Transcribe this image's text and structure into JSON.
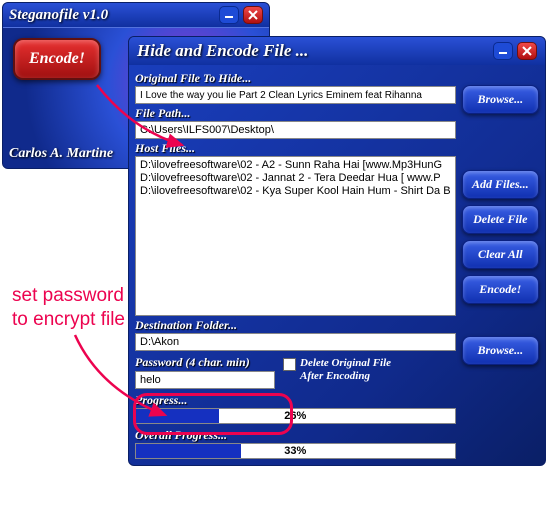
{
  "main": {
    "title": "Steganofile v1.0",
    "encode_btn": "Encode!",
    "author": "Carlos A. Martine"
  },
  "dialog": {
    "title": "Hide and Encode File ...",
    "labels": {
      "original": "Original File To Hide...",
      "file_path": "File Path...",
      "host_files": "Host Files...",
      "dest_folder": "Destination Folder...",
      "password": "Password (4 char. min)",
      "progress": "Progress...",
      "overall": "Overall Progress..."
    },
    "values": {
      "original": "I Love the way you lie Part 2 Clean Lyrics Eminem feat Rihanna",
      "file_path": "C:\\Users\\ILFS007\\Desktop\\",
      "dest_folder": "D:\\Akon",
      "password": "helo",
      "progress_pct": "26%",
      "overall_pct": "33%"
    },
    "host_files": [
      "D:\\ilovefreesoftware\\02 - A2 - Sunn Raha Hai [www.Mp3HunG",
      "D:\\ilovefreesoftware\\02 - Jannat 2 - Tera Deedar Hua [ www.P",
      "D:\\ilovefreesoftware\\02 - Kya Super Kool Hain Hum - Shirt Da B"
    ],
    "buttons": {
      "browse": "Browse...",
      "add_files": "Add Files...",
      "delete_file": "Delete File",
      "clear_all": "Clear All",
      "encode": "Encode!",
      "browse2": "Browse..."
    },
    "checkbox": "Delete Original File\nAfter Encoding"
  },
  "annotation": {
    "text1": "set password",
    "text2": "to encrypt file"
  }
}
